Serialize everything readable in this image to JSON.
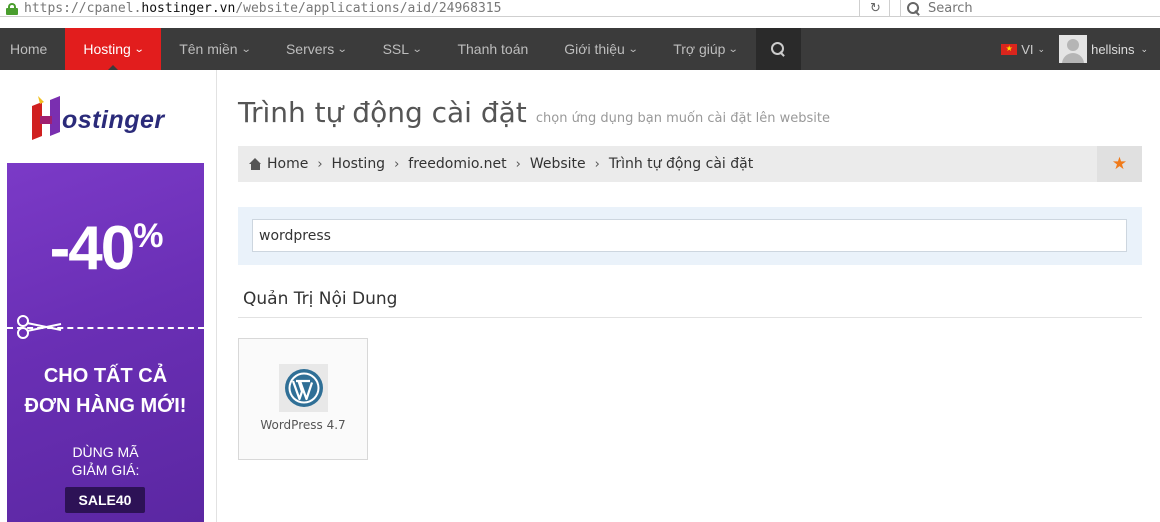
{
  "browser": {
    "url_prefix": "https://cpanel.",
    "url_host": "hostinger.vn",
    "url_path": "/website/applications/aid/24968315",
    "search_placeholder": "Search"
  },
  "nav": {
    "items": [
      {
        "label": "Home",
        "has_dropdown": false
      },
      {
        "label": "Hosting",
        "has_dropdown": true,
        "active": true
      },
      {
        "label": "Tên miền",
        "has_dropdown": true
      },
      {
        "label": "Servers",
        "has_dropdown": true
      },
      {
        "label": "SSL",
        "has_dropdown": true
      },
      {
        "label": "Thanh toán",
        "has_dropdown": false
      },
      {
        "label": "Giới thiệu",
        "has_dropdown": true
      },
      {
        "label": "Trợ giúp",
        "has_dropdown": true
      }
    ],
    "language": "VI",
    "username": "hellsins",
    "active_color": "#e21d1d"
  },
  "sidebar": {
    "logo_text": "ostinger",
    "banner": {
      "discount": "-40",
      "percent": "%",
      "headline_1": "CHO TẤT CẢ",
      "headline_2": "ĐƠN HÀNG MỚI!",
      "sub_1": "DÙNG MÃ",
      "sub_2": "GIẢM GIÁ:",
      "code": "SALE40",
      "color": "#6a2fb5"
    }
  },
  "main": {
    "title": "Trình tự động cài đặt",
    "subtitle": "chọn ứng dụng bạn muốn cài đặt lên website",
    "breadcrumb": [
      "Home",
      "Hosting",
      "freedomio.net",
      "Website",
      "Trình tự động cài đặt"
    ],
    "search_value": "wordpress",
    "section_title": "Quản Trị Nội Dung",
    "apps": [
      {
        "name": "WordPress 4.7",
        "icon": "wordpress-icon"
      }
    ],
    "star_color": "#f07a1a"
  }
}
